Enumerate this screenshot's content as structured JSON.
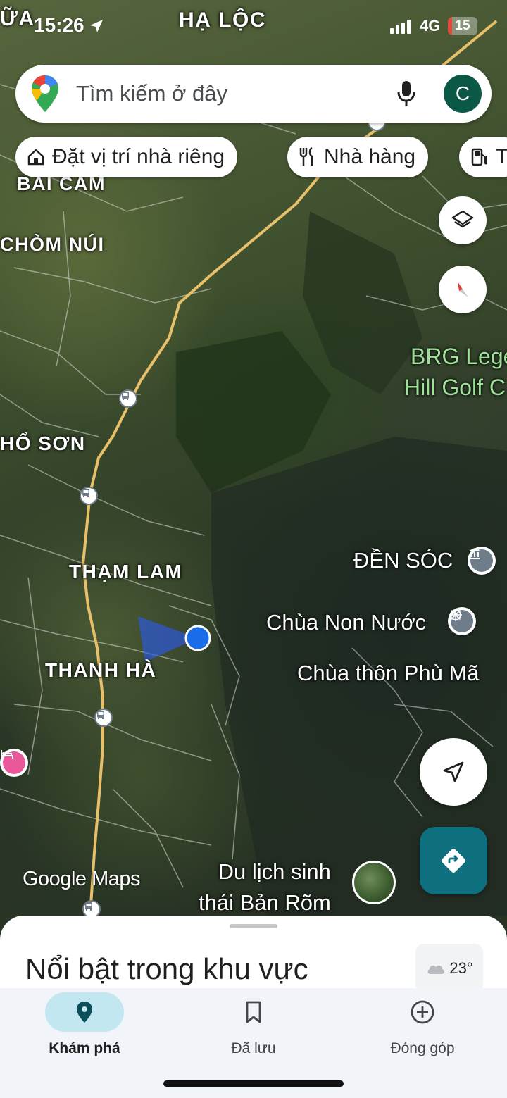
{
  "status_bar": {
    "time": "15:26",
    "network": "4G",
    "battery": "15",
    "battery_level": 0.15,
    "icons": [
      "location-arrow-icon",
      "signal-icon",
      "battery-icon"
    ]
  },
  "search": {
    "placeholder": "Tìm kiếm ở đây",
    "avatar_letter": "C",
    "icons": [
      "maps-pin-logo",
      "mic-icon"
    ]
  },
  "chips": [
    {
      "label": "Đặt vị trí nhà riêng",
      "icon": "home-icon"
    },
    {
      "label": "Nhà hàng",
      "icon": "restaurant-icon"
    },
    {
      "label": "T",
      "icon": "gas-station-icon"
    }
  ],
  "map": {
    "area_labels": [
      "HẠ LỘC",
      "BÃI CẤM",
      "CHÒM NÚI",
      "HỔ SƠN",
      "THẠM LAM",
      "THANH HÀ",
      "ỮA"
    ],
    "places": {
      "golf_line1": "BRG Lege",
      "golf_line2": "Hill Golf C",
      "den_soc": "ĐỀN SÓC",
      "chua_non_nuoc": "Chùa Non Nước",
      "chua_thon_phu_ma": "Chùa thôn Phù Mã",
      "du_lich_line1": "Du lịch sinh",
      "du_lich_line2": "thái Bản Rõm"
    },
    "attribution": "Google Maps",
    "colors": {
      "road": "#e8c06a",
      "location": "#1a6ce8",
      "golf_text": "#9ee29a"
    }
  },
  "buttons": {
    "layers": "layers-icon",
    "compass": "compass-icon",
    "my_location": "navigation-arrow-icon",
    "directions": "directions-icon"
  },
  "sheet": {
    "title": "Nổi bật trong khu vực",
    "weather": "23°"
  },
  "nav": [
    {
      "label": "Khám phá",
      "icon": "explore-pin-icon",
      "active": true
    },
    {
      "label": "Đã lưu",
      "icon": "bookmark-icon",
      "active": false
    },
    {
      "label": "Đóng góp",
      "icon": "add-circle-icon",
      "active": false
    }
  ]
}
